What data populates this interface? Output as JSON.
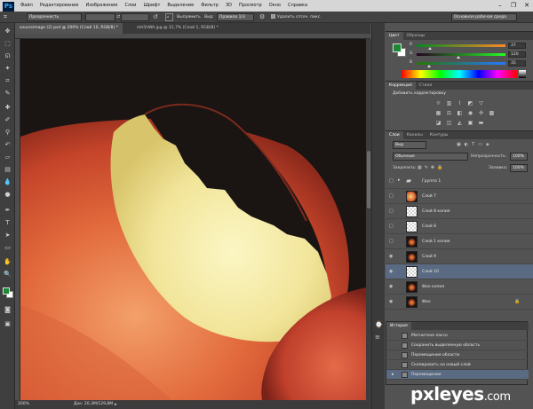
{
  "menubar": {
    "logo": "Ps",
    "items": [
      "Файл",
      "Редактирование",
      "Изображение",
      "Слои",
      "Шрифт",
      "Выделение",
      "Фильтр",
      "3D",
      "Просмотр",
      "Окно",
      "Справка"
    ],
    "window_controls": [
      "–",
      "❐",
      "✕"
    ]
  },
  "options": {
    "mode": "Прозрачность",
    "align_btn": "Выпрямить",
    "view_label": "Вид:",
    "view_value": "Правило 1/3",
    "delete_cropped": "Удалить отсеч. пикс.",
    "workspace": "Основная рабочая среда"
  },
  "tabs": [
    {
      "label": "sourceimage (2).psd @ 200% (Слой 10, RGB/8) *"
    },
    {
      "label": "mh5hWA.jpg @ 31,7% (Слой 1, RGB/8) *"
    }
  ],
  "status": {
    "zoom": "200%",
    "doc": "Док: 20,3M/129,8M"
  },
  "color_panel": {
    "tabs": [
      "Цвет",
      "Образцы"
    ],
    "r": "37",
    "g": "120",
    "b": "35",
    "r_pos": 0.15,
    "g_pos": 0.47,
    "b_pos": 0.14
  },
  "adjustments_panel": {
    "tabs": [
      "Коррекция",
      "Стили"
    ],
    "title": "Добавить корректировку"
  },
  "layers_panel": {
    "tabs": [
      "Слои",
      "Каналы",
      "Контуры"
    ],
    "filter": "Вид",
    "blend_mode": "Обычные",
    "opacity_label": "Непрозрачность:",
    "opacity_value": "100%",
    "lock_label": "Закрепить:",
    "fill_label": "Заливка:",
    "fill_value": "100%",
    "layers": [
      {
        "name": "Группа 1",
        "type": "group",
        "visible": false
      },
      {
        "name": "Слой 7",
        "type": "apple",
        "visible": false
      },
      {
        "name": "Слой 8 копия",
        "type": "checker",
        "visible": false
      },
      {
        "name": "Слой 8",
        "type": "checker",
        "visible": false
      },
      {
        "name": "Слой 1 копия",
        "type": "dark",
        "visible": false
      },
      {
        "name": "Слой 9",
        "type": "dark",
        "visible": true
      },
      {
        "name": "Слой 10",
        "type": "checker",
        "visible": true,
        "selected": true
      },
      {
        "name": "Фон копия",
        "type": "dark",
        "visible": true
      },
      {
        "name": "Фон",
        "type": "dark",
        "visible": true
      }
    ]
  },
  "history_panel": {
    "title": "История",
    "items": [
      "Магнитное лассо",
      "Сохранить выделенную область",
      "Перемещение области",
      "Скопировать на новый слой",
      "Перемещение"
    ]
  },
  "watermark": {
    "brand": "pxleyes",
    "suffix": ".com"
  },
  "colors": {
    "foreground": "#1c8a35",
    "background": "#ffffff",
    "selection": "#5a6a82"
  }
}
